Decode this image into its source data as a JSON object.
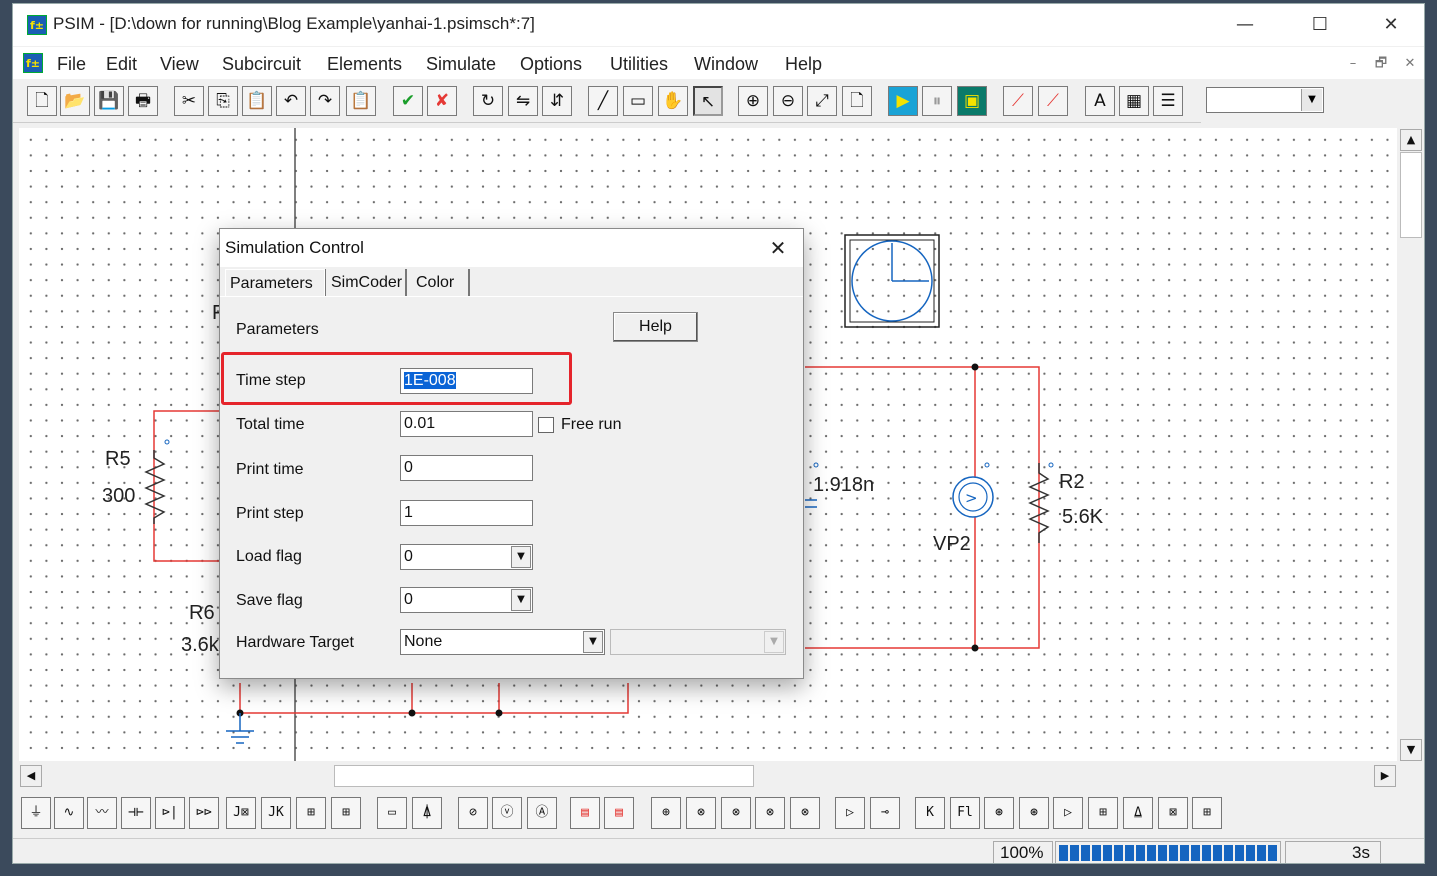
{
  "window": {
    "title": "PSIM - [D:\\down for running\\Blog Example\\yanhai-1.psimsch*:7]",
    "minimize_glyph": "—",
    "maximize_glyph": "☐",
    "close_glyph": "✕"
  },
  "menu": [
    "File",
    "Edit",
    "View",
    "Subcircuit",
    "Elements",
    "Simulate",
    "Options",
    "Utilities",
    "Window",
    "Help"
  ],
  "mdi_controls": [
    "–",
    "🗗",
    "✕"
  ],
  "toolbar": {
    "buttons": [
      "new-icon",
      "open-icon",
      "save-icon",
      "print-icon",
      "cut-icon",
      "copy-icon",
      "paste-icon",
      "undo-icon",
      "redo-icon",
      "clipboard-icon",
      "check-icon",
      "cross-icon",
      "rotate-icon",
      "flip-lr-icon",
      "flip-tb-icon",
      "wire-icon",
      "label-icon",
      "pan-hand-icon",
      "select-arrow-icon",
      "zoom-in-icon",
      "zoom-out-icon",
      "zoom-fit-icon",
      "page-icon",
      "run-simulation-icon",
      "pause-icon",
      "simview-icon",
      "probe-icon",
      "probe-diff-icon",
      "text-icon",
      "element-list-icon",
      "element-browser-icon"
    ],
    "glyphs": [
      "🗋",
      "📂",
      "💾",
      "🖶",
      "✂",
      "⎘",
      "📋",
      "↶",
      "↷",
      "📋",
      "✔",
      "✘",
      "↻",
      "⇋",
      "⇵",
      "╱",
      "▭",
      "✋",
      "↖",
      "⊕",
      "⊖",
      "⤢",
      "🗋",
      "▶",
      "⏸",
      "▣",
      "⟋",
      "⟋",
      "A",
      "▦",
      "☰"
    ],
    "combo_value": ""
  },
  "canvas": {
    "labels": {
      "r5_name": "R5",
      "r5_value": "300",
      "r6_name": "R6",
      "r6_value": "3.6k",
      "cap_value": "1.918n",
      "r2_name": "R2",
      "r2_value": "5.6K",
      "vp2_name": "VP2",
      "partial_label": "F"
    }
  },
  "dialog": {
    "title": "Simulation Control",
    "close_glyph": "✕",
    "tabs": [
      "Parameters",
      "SimCoder",
      "Color"
    ],
    "section": "Parameters",
    "help_button": "Help",
    "fields": {
      "time_step": {
        "label": "Time step",
        "value": "1E-008"
      },
      "total_time": {
        "label": "Total time",
        "value": "0.01"
      },
      "print_time": {
        "label": "Print time",
        "value": "0"
      },
      "print_step": {
        "label": "Print step",
        "value": "1"
      },
      "load_flag": {
        "label": "Load flag",
        "value": "0"
      },
      "save_flag": {
        "label": "Save flag",
        "value": "0"
      },
      "hardware_target": {
        "label": "Hardware Target",
        "value": "None",
        "secondary_value": ""
      }
    },
    "free_run_label": "Free run",
    "free_run_checked": false,
    "highlight_color": "#e5242b"
  },
  "library_bar": {
    "items": [
      "resistor-icon",
      "rl-icon",
      "rlc-icon",
      "capacitor-icon",
      "diode-icon",
      "diode2-icon",
      "thyristor-icon",
      "jk-ff-icon",
      "switch-block-icon",
      "switch-block2-icon",
      "meter-icon",
      "ground-arrow-icon",
      "voltage-probe-icon",
      "voltmeter-icon",
      "ammeter-icon",
      "scope-icon",
      "scope2-icon",
      "source1-icon",
      "source2-icon",
      "source3-icon",
      "source4-icon",
      "source5-icon",
      "comparator-icon",
      "probe-pin-icon",
      "k-block-icon",
      "pi-block-icon",
      "gain-icon",
      "gain2-icon",
      "op-amp-icon",
      "sum-block-icon",
      "ground2-icon",
      "multiplier-icon",
      "divider-icon"
    ],
    "glyphs": [
      "⏚",
      "∿",
      "〰",
      "⊣⊢",
      "⊳|",
      "⊳⊳",
      "J⊠",
      "JK",
      "⊞",
      "⊞",
      "▭",
      "⍋",
      "⊘",
      "ⓥ",
      "Ⓐ",
      "▤",
      "▤",
      "⊕",
      "⊗",
      "⊗",
      "⊗",
      "⊗",
      "▷",
      "⊸",
      "K",
      "Fl",
      "⊛",
      "⊛",
      "▷",
      "⊞",
      "⍙",
      "⊠",
      "⊞"
    ]
  },
  "status": {
    "zoom": "100%",
    "progress_fraction": 1.0,
    "time": "3s"
  }
}
